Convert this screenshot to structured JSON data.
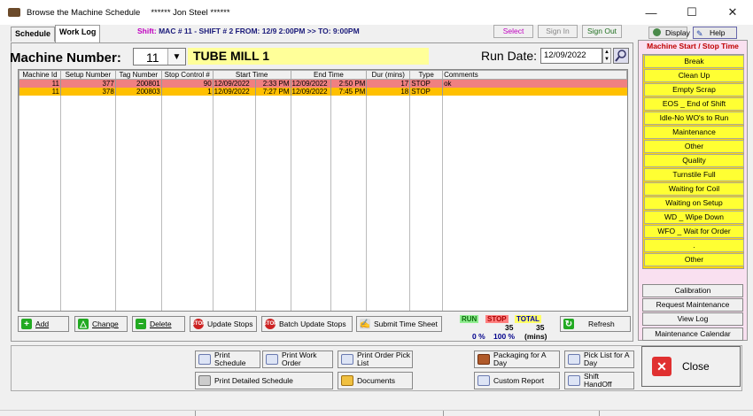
{
  "window": {
    "title": "Browse the Machine Schedule",
    "user": "****** Jon Steel ******",
    "min_glyph": "—",
    "max_glyph": "☐",
    "close_glyph": "✕"
  },
  "tabs": [
    {
      "label": "Schedule"
    },
    {
      "label": "Work Log"
    }
  ],
  "shift": {
    "label": "Shift:",
    "text": "MAC # 11 - SHIFT # 2 FROM: 12/9  2:00PM >> TO:  9:00PM"
  },
  "top_buttons": {
    "select": "Select",
    "sign_in": "Sign In",
    "sign_out": "Sign Out",
    "display": "Display",
    "help": "Help"
  },
  "machine": {
    "label": "Machine Number:",
    "number": "11",
    "name": "TUBE MILL 1"
  },
  "run_date": {
    "label": "Run Date:",
    "value": "12/09/2022"
  },
  "table": {
    "columns": [
      "Machine Id",
      "Setup Number",
      "Tag Number",
      "Stop Control #",
      "Start Time",
      "",
      "End Time",
      "",
      "Dur (mins)",
      "Type",
      "Comments"
    ],
    "rows": [
      {
        "machine_id": "11",
        "setup": "377",
        "tag": "200801",
        "stop_control": "90",
        "start_date": "12/09/2022",
        "start_time": "2:33 PM",
        "end_date": "12/09/2022",
        "end_time": "2:50 PM",
        "dur": "17",
        "type": "STOP",
        "comments": "ok"
      },
      {
        "machine_id": "11",
        "setup": "378",
        "tag": "200803",
        "stop_control": "1",
        "start_date": "12/09/2022",
        "start_time": "7:27 PM",
        "end_date": "12/09/2022",
        "end_time": "7:45 PM",
        "dur": "18",
        "type": "STOP",
        "comments": ""
      }
    ]
  },
  "actions": {
    "add": "Add",
    "change": "Change",
    "delete": "Delete",
    "update_stops": "Update Stops",
    "batch_update_stops": "Batch Update Stops",
    "submit_time_sheet": "Submit Time Sheet",
    "refresh": "Refresh"
  },
  "summary": {
    "run_label": "RUN",
    "stop_label": "STOP",
    "total_label": "TOTAL",
    "stop_mins": "35",
    "total_mins": "35",
    "run_pct": "0 %",
    "stop_pct": "100 %",
    "units": "(mins)",
    "colors": {
      "run": "#90ee90",
      "stop": "#ff8080",
      "total": "#ffff66"
    }
  },
  "right_panel": {
    "title": "Machine Start / Stop Time",
    "reasons": [
      "Break",
      "Clean Up",
      "Empty Scrap",
      "EOS _ End of Shift",
      "Idle-No WO's to Run",
      "Maintenance",
      "Other",
      "Quality",
      "Turnstile Full",
      "Waiting for Coil",
      "Waiting on Setup",
      "WD _ Wipe Down",
      "WFO _ Wait for Order",
      ".",
      "Other"
    ],
    "buttons": [
      "Calibration",
      "Request Maintenance",
      "View Log",
      "Maintenance Calendar"
    ]
  },
  "bottom": {
    "print_schedule": "Print\nSchedule",
    "print_work_order": "Print Work\nOrder",
    "print_order_pick_list": "Print Order Pick\nList",
    "print_detailed_schedule": "Print Detailed Schedule",
    "documents": "Documents",
    "packaging_for_a_day": "Packaging for A\nDay",
    "pick_list_for_a_day": "Pick List for A\nDay",
    "custom_report": "Custom Report",
    "shift_handoff": "Shift\nHandOff",
    "close": "Close"
  }
}
